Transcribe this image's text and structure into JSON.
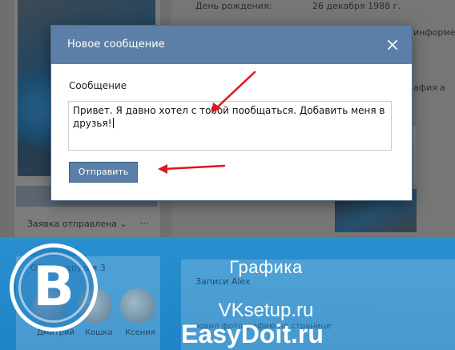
{
  "background_profile": {
    "birthday_label": "День рождения:",
    "birthday_value": "26 декабря 1988 г.",
    "right_snippet_1": "информе",
    "right_snippet_2": "афия",
    "right_snippet_3": "а",
    "friend_request_button": "Заявка отправлена",
    "more_button": "···",
    "common_friends_label": "Общие друзья 3",
    "posts_header": "Записи Alex",
    "post_snippet": "новил фотографию на странице",
    "friends": [
      {
        "name": "Дмитрий"
      },
      {
        "name": "Кошка"
      },
      {
        "name": "Ксения"
      }
    ]
  },
  "modal": {
    "title": "Новое сообщение",
    "field_label": "Сообщение",
    "message_text": "Привет. Я давно хотел с тобой пообщаться. Добавить меня в друзья!",
    "send_button_label": "Отправить"
  },
  "watermark": {
    "line1": "Графика",
    "line2": "VKsetup.ru",
    "line3": "EasyDoit.ru",
    "logo_letter": "B"
  },
  "annotations": {
    "arrow_color": "#e0141e"
  },
  "colors": {
    "header_blue": "#5b7fa6",
    "banner_blue": "#2a8fcf"
  }
}
